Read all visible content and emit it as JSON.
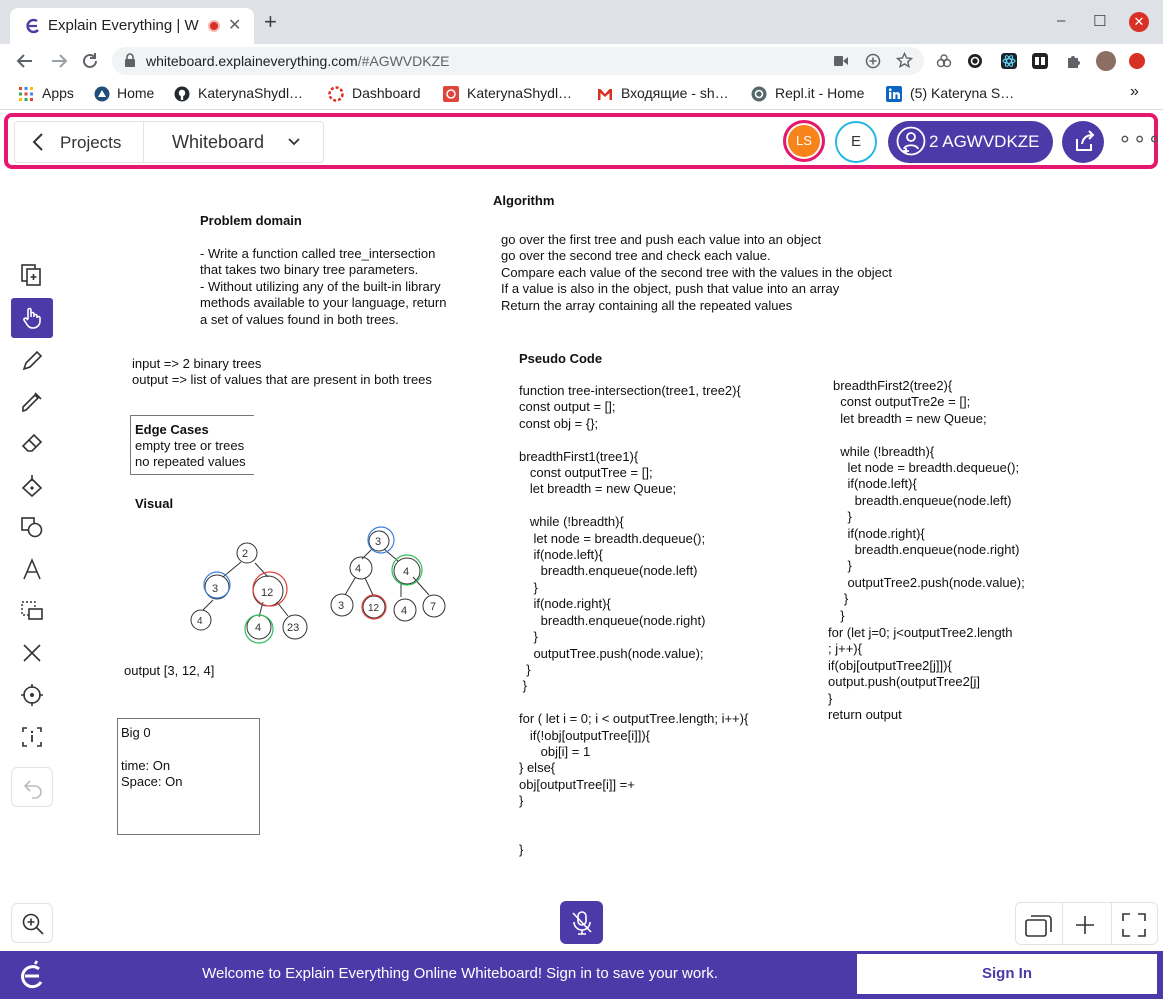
{
  "browser": {
    "tab_title": "Explain Everything | W",
    "tab_close": "✕",
    "new_tab": "+",
    "window_controls": [
      "–",
      "☐",
      "✕"
    ],
    "url_host": "whiteboard.explaineverything.com",
    "url_rest": "/#AGWVDKZE",
    "bookmarks": [
      {
        "label": "Apps",
        "icon": "apps-grid-icon"
      },
      {
        "label": "Home",
        "icon": "home-logo-icon"
      },
      {
        "label": "KaterynaShydl…",
        "icon": "github-icon"
      },
      {
        "label": "Dashboard",
        "icon": "dashboard-icon"
      },
      {
        "label": "KaterynaShydl…",
        "icon": "codewars-icon"
      },
      {
        "label": "Входящие - sh…",
        "icon": "gmail-icon"
      },
      {
        "label": "Repl.it - Home",
        "icon": "replit-icon"
      },
      {
        "label": "(5) Kateryna S…",
        "icon": "linkedin-icon"
      }
    ],
    "bookmarks_more": "»"
  },
  "header": {
    "projects_label": "Projects",
    "whiteboard_label": "Whiteboard",
    "avatar_ls": "LS",
    "avatar_e": "E",
    "session_label": "2 AGWVDKZE",
    "more_label": "∘∘∘"
  },
  "colors": {
    "brand_purple": "#4b3aa8",
    "header_border_pink": "#e6176e",
    "avatar_orange": "#f7841b",
    "avatar_cyan": "#27b7e3"
  },
  "canvas": {
    "problem_title": "Problem domain",
    "problem_text": "- Write a function called tree_intersection\nthat takes two binary tree parameters.\n- Without utilizing any of the built-in library\nmethods available to your language, return\na set of values found in both trees.",
    "io_text": "input => 2 binary trees\noutput => list of values that are present in both trees",
    "edge_title": "Edge Cases",
    "edge_text": "empty tree or trees\nno repeated values",
    "visual_title": "Visual",
    "output_text": "output [3, 12, 4]",
    "bigo_text": "Big 0\n\ntime: On\nSpace: On",
    "algorithm_title": "Algorithm",
    "algorithm_text": "go over the first tree and push each value into an object\ngo over the second tree and check each value.\nCompare each value of the second tree with the values in the object\nIf a value is also in the object, push that value into an array\nReturn the array containing all the repeated values",
    "pseudo_title": "Pseudo Code",
    "pseudo_left": "function tree-intersection(tree1, tree2){\nconst output = [];\nconst obj = {};\n\nbreadthFirst1(tree1){\n   const outputTree = [];\n   let breadth = new Queue;\n\n   while (!breadth){\n    let node = breadth.dequeue();\n    if(node.left){\n      breadth.enqueue(node.left)\n    }\n    if(node.right){\n      breadth.enqueue(node.right)\n    }\n    outputTree.push(node.value);\n  }\n }\n\nfor ( let i = 0; i < outputTree.length; i++){\n   if(!obj[outputTree[i]]){\n      obj[i] = 1\n} else{\nobj[outputTree[i]] =+\n}\n\n\n}",
    "pseudo_right_top": "breadthFirst2(tree2){\n  const outputTre2e = [];\n  let breadth = new Queue;\n\n  while (!breadth){\n    let node = breadth.dequeue();\n    if(node.left){\n      breadth.enqueue(node.left)\n    }\n    if(node.right){\n      breadth.enqueue(node.right)\n    }\n    outputTree2.push(node.value);\n   }\n  }",
    "pseudo_right_bottom": "for (let j=0; j<outputTree2.length\n; j++){\nif(obj[outputTree2[j]]){\noutput.push(outputTree2[j]\n}\nreturn output",
    "tree1_nodes": [
      "2",
      "3",
      "12",
      "4",
      "4",
      "23"
    ],
    "tree2_nodes": [
      "3",
      "4",
      "4",
      "3",
      "12",
      "4",
      "7"
    ]
  },
  "footer": {
    "welcome": "Welcome to Explain Everything Online Whiteboard! Sign in to save your work.",
    "signin": "Sign In"
  }
}
